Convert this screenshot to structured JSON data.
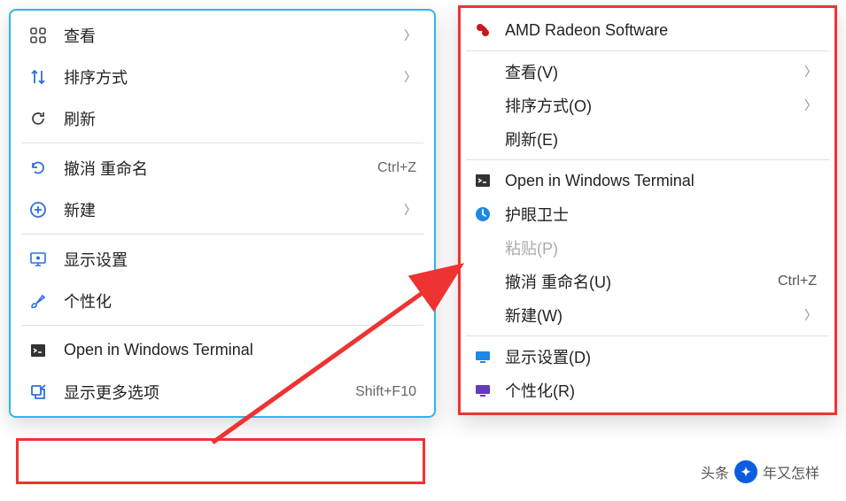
{
  "left_menu": {
    "view": "查看",
    "sort": "排序方式",
    "refresh": "刷新",
    "undo_rename": "撤消 重命名",
    "undo_shortcut": "Ctrl+Z",
    "new": "新建",
    "display_settings": "显示设置",
    "personalize": "个性化",
    "terminal": "Open in Windows Terminal",
    "more_options": "显示更多选项",
    "more_shortcut": "Shift+F10"
  },
  "right_menu": {
    "amd": "AMD Radeon Software",
    "view": "查看(V)",
    "sort": "排序方式(O)",
    "refresh": "刷新(E)",
    "terminal": "Open in Windows Terminal",
    "eye_guard": "护眼卫士",
    "paste": "粘贴(P)",
    "undo_rename": "撤消 重命名(U)",
    "undo_shortcut": "Ctrl+Z",
    "new": "新建(W)",
    "display_settings": "显示设置(D)",
    "personalize": "个性化(R)"
  },
  "watermark": {
    "prefix": "头条",
    "suffix": "年又怎样"
  }
}
